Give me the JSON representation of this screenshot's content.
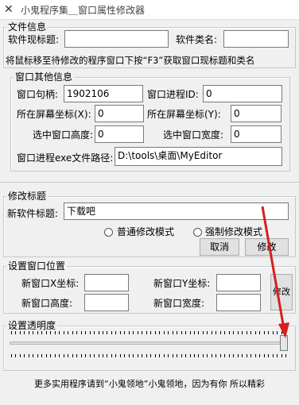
{
  "window": {
    "title": "小鬼程序集＿窗口属性修改器",
    "app_icon": "app-icon"
  },
  "file_info": {
    "legend": "文件信息",
    "title_label": "软件现标题:",
    "title_value": "",
    "class_label": "软件类名:",
    "class_value": "",
    "hint": "将鼠标移至待修改的程序窗口下按“F3”获取窗口现标题和类名"
  },
  "other_info": {
    "legend": "窗口其他信息",
    "handle_label": "窗口句柄:",
    "handle_value": "1902106",
    "pid_label": "窗口进程ID:",
    "pid_value": "0",
    "x_label": "所在屏幕坐标(X):",
    "x_value": "0",
    "y_label": "所在屏幕坐标(Y):",
    "y_value": "0",
    "height_label": "选中窗口高度:",
    "height_value": "0",
    "width_label": "选中窗口宽度:",
    "width_value": "0",
    "path_label": "窗口进程exe文件路径:",
    "path_value": "D:\\tools\\桌面\\MyEditor"
  },
  "modify_title": {
    "legend": "修改标题",
    "new_title_label": "新软件标题:",
    "new_title_value": "下载吧",
    "mode_normal": "普通修改模式",
    "mode_force": "强制修改模式",
    "cancel_label": "取消",
    "modify_label": "修改"
  },
  "window_pos": {
    "legend": "设置窗口位置",
    "x_label": "新窗口X坐标:",
    "y_label": "新窗口Y坐标:",
    "height_label": "新窗口高度:",
    "width_label": "新窗口宽度:",
    "x_value": "",
    "y_value": "",
    "height_value": "",
    "width_value": "",
    "modify_label": "修改"
  },
  "transparency": {
    "legend": "设置透明度",
    "level": 1.0
  },
  "footer": {
    "text": "更多实用程序请到“小鬼领地”小鬼领地，因为有你 所以精彩"
  },
  "watermark": {
    "text": "下载吧"
  },
  "colors": {
    "arrow": "#d42020",
    "window_bg": "#f0f0f0"
  }
}
